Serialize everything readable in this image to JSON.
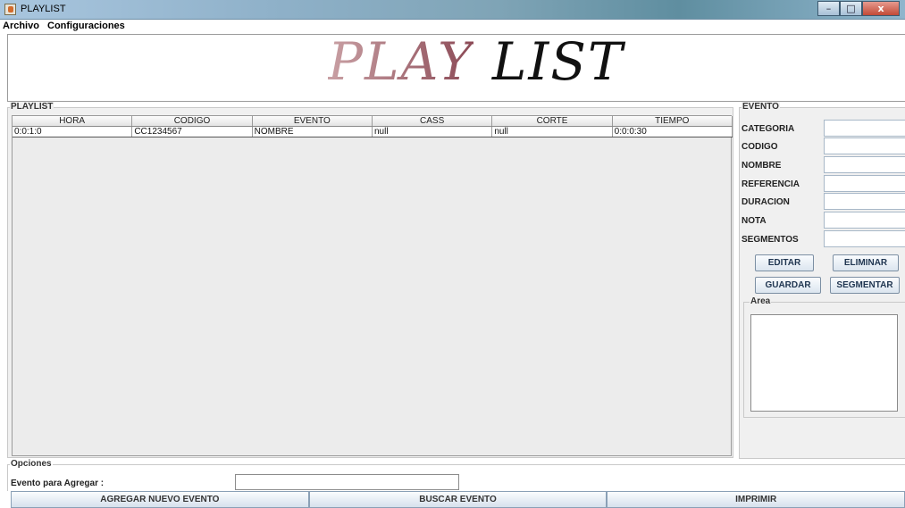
{
  "window": {
    "title": "PLAYLIST",
    "buttons": {
      "minimize": "–",
      "maximize": "□",
      "close": "x"
    }
  },
  "menu": [
    "Archivo",
    "Configuraciones"
  ],
  "banner": {
    "word1": "PLAY",
    "word2": "LIST"
  },
  "playlist": {
    "label": "PLAYLIST",
    "columns": [
      "HORA",
      "CODIGO",
      "EVENTO",
      "CASS",
      "CORTE",
      "TIEMPO"
    ],
    "rows": [
      [
        "0:0:1:0",
        "CC1234567",
        "NOMBRE",
        "null",
        "null",
        "0:0:0:30"
      ]
    ]
  },
  "evento": {
    "label": "EVENTO",
    "fields": [
      {
        "label": "CATEGORIA",
        "value": ""
      },
      {
        "label": "CODIGO",
        "value": ""
      },
      {
        "label": "NOMBRE",
        "value": ""
      },
      {
        "label": "REFERENCIA",
        "value": ""
      },
      {
        "label": "DURACION",
        "value": ""
      },
      {
        "label": "NOTA",
        "value": ""
      },
      {
        "label": "SEGMENTOS",
        "value": ""
      }
    ],
    "buttons": {
      "editar": "EDITAR",
      "eliminar": "ELIMINAR",
      "guardar": "GUARDAR",
      "segmentar": "SEGMENTAR"
    },
    "area_label": "Area",
    "area_value": ""
  },
  "opciones": {
    "label": "Opciones",
    "field_label": "Evento para Agregar :",
    "field_value": ""
  },
  "bottom_buttons": [
    "AGREGAR NUEVO EVENTO",
    "BUSCAR EVENTO",
    "IMPRIMIR"
  ]
}
